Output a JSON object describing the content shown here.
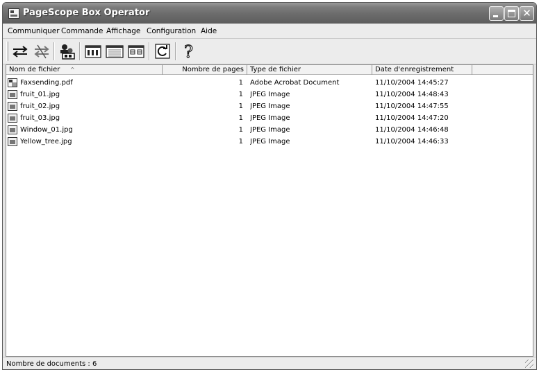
{
  "window": {
    "title": "PageScope Box Operator"
  },
  "menu": [
    "Communiquer",
    "Commande",
    "Affichage",
    "Configuration",
    "Aide"
  ],
  "toolbar": {
    "icons": [
      "send-icon",
      "cancel-send-icon",
      "users-icon",
      "large-icons-view-icon",
      "list-view-icon",
      "details-view-icon",
      "refresh-icon",
      "help-icon"
    ],
    "help_glyph": "?"
  },
  "columns": {
    "name": "Nom de fichier",
    "pages": "Nombre de pages",
    "type": "Type de fichier",
    "date": "Date d'enregistrement",
    "sort_indicator": "^"
  },
  "files": [
    {
      "name": "Faxsending.pdf",
      "pages": "1",
      "type": "Adobe Acrobat Document",
      "date": "11/10/2004 14:45:27",
      "icon": "pdf-file-icon"
    },
    {
      "name": "fruit_01.jpg",
      "pages": "1",
      "type": "JPEG Image",
      "date": "11/10/2004 14:48:43",
      "icon": "image-file-icon"
    },
    {
      "name": "fruit_02.jpg",
      "pages": "1",
      "type": "JPEG Image",
      "date": "11/10/2004 14:47:55",
      "icon": "image-file-icon"
    },
    {
      "name": "fruit_03.jpg",
      "pages": "1",
      "type": "JPEG Image",
      "date": "11/10/2004 14:47:20",
      "icon": "image-file-icon"
    },
    {
      "name": "Window_01.jpg",
      "pages": "1",
      "type": "JPEG Image",
      "date": "11/10/2004 14:46:48",
      "icon": "image-file-icon"
    },
    {
      "name": "Yellow_tree.jpg",
      "pages": "1",
      "type": "JPEG Image",
      "date": "11/10/2004 14:46:33",
      "icon": "image-file-icon"
    }
  ],
  "status": {
    "text": "Nombre de documents : 6"
  }
}
